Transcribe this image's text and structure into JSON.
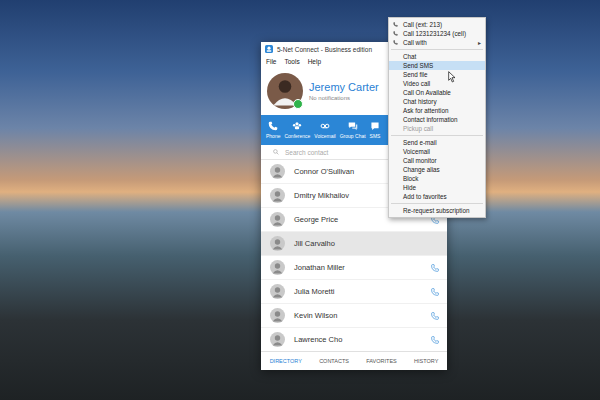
{
  "window": {
    "title": "5-Net Connect - Business edition",
    "menu": [
      "File",
      "Tools",
      "Help"
    ]
  },
  "profile": {
    "name": "Jeremy Carter",
    "status_text": "No notifications",
    "online": true
  },
  "toolbar": [
    {
      "label": "Phone"
    },
    {
      "label": "Conference"
    },
    {
      "label": "Voicemail"
    },
    {
      "label": "Group Chat"
    },
    {
      "label": "SMS"
    }
  ],
  "search": {
    "placeholder": "Search contact"
  },
  "contacts": [
    {
      "name": "Connor O'Sullivan",
      "selected": false,
      "phone_icon": true
    },
    {
      "name": "Dmitry Mikhailov",
      "selected": false,
      "phone_icon": true
    },
    {
      "name": "George Price",
      "selected": false,
      "phone_icon": true
    },
    {
      "name": "Jill Carvalho",
      "selected": true,
      "phone_icon": false
    },
    {
      "name": "Jonathan Miller",
      "selected": false,
      "phone_icon": true
    },
    {
      "name": "Julia Moretti",
      "selected": false,
      "phone_icon": true
    },
    {
      "name": "Kevin Wilson",
      "selected": false,
      "phone_icon": true
    },
    {
      "name": "Lawrence Cho",
      "selected": false,
      "phone_icon": true
    }
  ],
  "tabs": [
    {
      "label": "DIRECTORY",
      "selected": true
    },
    {
      "label": "CONTACTS",
      "selected": false
    },
    {
      "label": "FAVORITES",
      "selected": false
    },
    {
      "label": "HISTORY",
      "selected": false
    }
  ],
  "context_menu": [
    {
      "label": "Call (ext: 213)",
      "kind": "call",
      "selected": false,
      "disabled": false
    },
    {
      "label": "Call 1231231234 (cell)",
      "kind": "call",
      "selected": false,
      "disabled": false
    },
    {
      "label": "Call with",
      "kind": "submenu",
      "arrow": "▸",
      "selected": false,
      "disabled": false
    },
    {
      "label": "",
      "kind": "separator",
      "selected": false,
      "disabled": false
    },
    {
      "label": "Chat",
      "kind": "item",
      "selected": false,
      "disabled": false
    },
    {
      "label": "Send SMS",
      "kind": "item",
      "selected": true,
      "disabled": false
    },
    {
      "label": "Send file",
      "kind": "item",
      "selected": false,
      "disabled": false
    },
    {
      "label": "Video call",
      "kind": "item",
      "selected": false,
      "disabled": false
    },
    {
      "label": "Call On Available",
      "kind": "item",
      "selected": false,
      "disabled": false
    },
    {
      "label": "Chat history",
      "kind": "item",
      "selected": false,
      "disabled": false
    },
    {
      "label": "Ask for attention",
      "kind": "item",
      "selected": false,
      "disabled": false
    },
    {
      "label": "Contact information",
      "kind": "item",
      "selected": false,
      "disabled": false
    },
    {
      "label": "Pickup call",
      "kind": "item",
      "selected": false,
      "disabled": true
    },
    {
      "label": "",
      "kind": "separator",
      "selected": false,
      "disabled": false
    },
    {
      "label": "Send e-mail",
      "kind": "item",
      "selected": false,
      "disabled": false
    },
    {
      "label": "Voicemail",
      "kind": "item",
      "selected": false,
      "disabled": false
    },
    {
      "label": "Call monitor",
      "kind": "item",
      "selected": false,
      "disabled": false
    },
    {
      "label": "Change alias",
      "kind": "item",
      "selected": false,
      "disabled": false
    },
    {
      "label": "Block",
      "kind": "item",
      "selected": false,
      "disabled": false
    },
    {
      "label": "Hide",
      "kind": "item",
      "selected": false,
      "disabled": false
    },
    {
      "label": "Add to favorites",
      "kind": "item",
      "selected": false,
      "disabled": false
    },
    {
      "label": "",
      "kind": "separator",
      "selected": false,
      "disabled": false
    },
    {
      "label": "Re-request subscription",
      "kind": "item",
      "selected": false,
      "disabled": false
    }
  ]
}
